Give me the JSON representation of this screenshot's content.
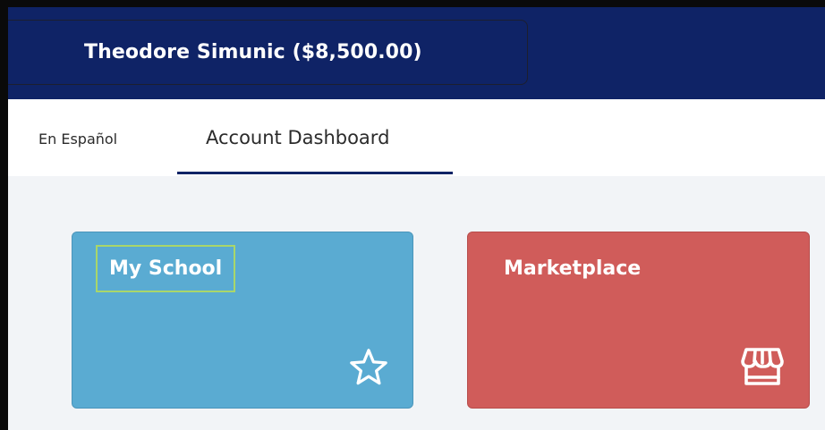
{
  "header": {
    "account_label": "Theodore Simunic ($8,500.00)"
  },
  "tabs": {
    "espanol": "En Español",
    "dashboard": "Account Dashboard"
  },
  "cards": [
    {
      "title": "My School",
      "icon": "star-icon",
      "color": "#5aabd2"
    },
    {
      "title": "Marketplace",
      "icon": "storefront-icon",
      "color": "#d05c5a"
    }
  ],
  "colors": {
    "header_bg": "#0f2366",
    "active_tab_underline": "#0f2366",
    "focus_outline": "#a9d66a"
  }
}
